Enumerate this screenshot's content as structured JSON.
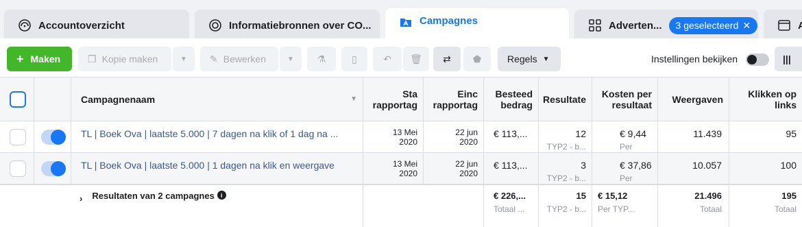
{
  "tabs": {
    "account": "Accountoverzicht",
    "sources": "Informatiebronnen over CO...",
    "campaigns": "Campagnes",
    "ads": "Adverten...",
    "ads_badge": "3 geselecteerd",
    "last": "Ac"
  },
  "toolbar": {
    "create": "Maken",
    "duplicate": "Kopie maken",
    "edit": "Bewerken",
    "rules": "Regels",
    "view_settings": "Instellingen bekijken"
  },
  "columns": {
    "name": "Campagnenaam",
    "start": "Sta rapportag",
    "end": "Einc rapportag",
    "spend": "Besteed bedrag",
    "results": "Resultate",
    "cost": "Kosten per resultaat",
    "impressions": "Weergaven",
    "clicks": "Klikken op links"
  },
  "rows": [
    {
      "name": "TL | Boek Ova | laatste 5.000 | 7 dagen na klik of 1 dag na ...",
      "start": "13 Mei",
      "start_year": "2020",
      "end": "22 jun",
      "end_year": "2020",
      "spend": "€ 113,...",
      "results": "12",
      "results_sub": "TYP2 - b...",
      "cost": "€ 9,44",
      "cost_sub": "Per TYP...",
      "impressions": "11.439",
      "clicks": "95"
    },
    {
      "name": "TL | Boek Ova | laatste 5.000 | 1 dagen na klik en weergave",
      "start": "13 Mei",
      "start_year": "2020",
      "end": "22 jun",
      "end_year": "2020",
      "spend": "€ 113,...",
      "results": "3",
      "results_sub": "TYP2 - b...",
      "cost": "€ 37,86",
      "cost_sub": "Per TYP...",
      "impressions": "10.057",
      "clicks": "100"
    }
  ],
  "totals": {
    "label": "Resultaten van 2 campagnes",
    "spend": "€ 226,...",
    "spend_sub": "Totaal ...",
    "results": "15",
    "results_sub": "TYP2 - b...",
    "cost": "€ 15,12",
    "cost_sub": "Per TYP...",
    "impressions": "21.496",
    "impressions_sub": "Totaal",
    "clicks": "195",
    "clicks_sub": "Totaal"
  }
}
